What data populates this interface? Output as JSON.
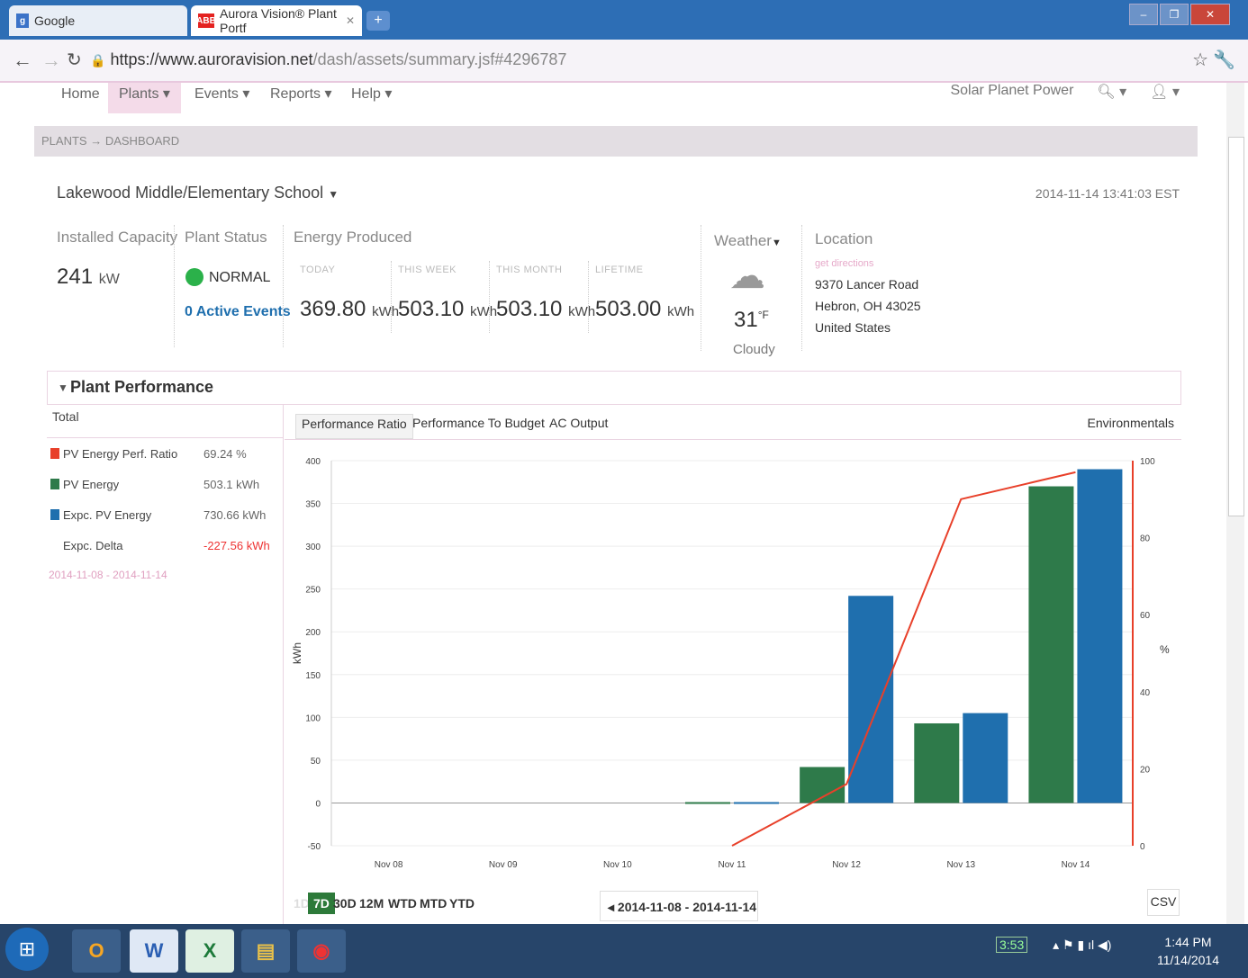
{
  "browser": {
    "tabs": [
      {
        "label": "Google",
        "favicon": "g-icon"
      },
      {
        "label": "Aurora Vision® Plant Portf",
        "favicon": "abb-icon"
      }
    ],
    "url_host": "https://www.auroravision.net",
    "url_path": "/dash/assets/summary.jsf#4296787"
  },
  "nav": {
    "items": [
      "Home",
      "Plants",
      "Events",
      "Reports",
      "Help"
    ],
    "company": "Solar Planet Power"
  },
  "breadcrumb": {
    "a": "PLANTS",
    "arrow": "→",
    "b": "DASHBOARD"
  },
  "plant": {
    "title": "Lakewood Middle/Elementary School",
    "timestamp": "2014-11-14 13:41:03 EST",
    "installed_capacity_label": "Installed Capacity",
    "installed_capacity_value": "241",
    "installed_capacity_unit": "kW",
    "status_label": "Plant Status",
    "status_value": "NORMAL",
    "active_events": "0 Active Events",
    "energy_label": "Energy Produced",
    "energy": [
      {
        "period": "TODAY",
        "value": "369.80",
        "unit": "kWh"
      },
      {
        "period": "THIS WEEK",
        "value": "503.10",
        "unit": "kWh"
      },
      {
        "period": "THIS MONTH",
        "value": "503.10",
        "unit": "kWh"
      },
      {
        "period": "LIFETIME",
        "value": "503.00",
        "unit": "kWh"
      }
    ],
    "weather_label": "Weather",
    "weather_temp": "31",
    "weather_unit": "°F",
    "weather_desc": "Cloudy",
    "location_label": "Location",
    "directions": "get directions",
    "address1": "9370 Lancer Road",
    "address2": "Hebron, OH  43025",
    "address3": "United States"
  },
  "performance": {
    "title": "Plant Performance",
    "total_label": "Total",
    "legend": [
      {
        "label": "PV Energy Perf. Ratio",
        "value": "69.24 %",
        "color": "#e8402a"
      },
      {
        "label": "PV Energy",
        "value": "503.1 kWh",
        "color": "#2e7a4a"
      },
      {
        "label": "Expc. PV Energy",
        "value": "730.66 kWh",
        "color": "#1f6fae"
      },
      {
        "label": "Expc. Delta",
        "value": "-227.56 kWh",
        "color": ""
      }
    ],
    "date_range": "2014-11-08 - 2014-11-14",
    "tabs": [
      "Performance Ratio",
      "Performance To Budget",
      "AC Output"
    ],
    "environmentals": "Environmentals",
    "ranges": [
      "1D",
      "7D",
      "30D",
      "12M",
      "WTD",
      "MTD",
      "YTD"
    ],
    "selector": "2014-11-08 -  2014-11-14",
    "csv": "CSV"
  },
  "chart_data": {
    "type": "bar",
    "categories": [
      "Nov 08",
      "Nov 09",
      "Nov 10",
      "Nov 11",
      "Nov 12",
      "Nov 13",
      "Nov 14"
    ],
    "ylabel": "kWh",
    "y2label": "%",
    "ylim": [
      -50,
      400
    ],
    "y2lim": [
      0,
      100
    ],
    "yticks": [
      400,
      350,
      300,
      250,
      200,
      150,
      100,
      50,
      0,
      -50
    ],
    "y2ticks": [
      100,
      80,
      60,
      40,
      20,
      0
    ],
    "series": [
      {
        "name": "PV Energy",
        "color": "#2e7a4a",
        "values": [
          0,
          0,
          0,
          1,
          42,
          93,
          370
        ]
      },
      {
        "name": "Expc. PV Energy",
        "color": "#1f6fae",
        "values": [
          0,
          0,
          0,
          1,
          242,
          105,
          390
        ]
      },
      {
        "name": "PV Energy Perf. Ratio",
        "color": "#e8402a",
        "axis": "right",
        "points": [
          [
            3,
            0
          ],
          [
            4,
            16
          ],
          [
            5,
            90
          ],
          [
            6,
            97
          ]
        ]
      }
    ]
  },
  "taskbar": {
    "apps": [
      "outlook-icon",
      "word-icon",
      "excel-icon",
      "explorer-icon",
      "chrome-icon"
    ],
    "battery": "3:53",
    "time": "1:44 PM",
    "date": "11/14/2014"
  }
}
